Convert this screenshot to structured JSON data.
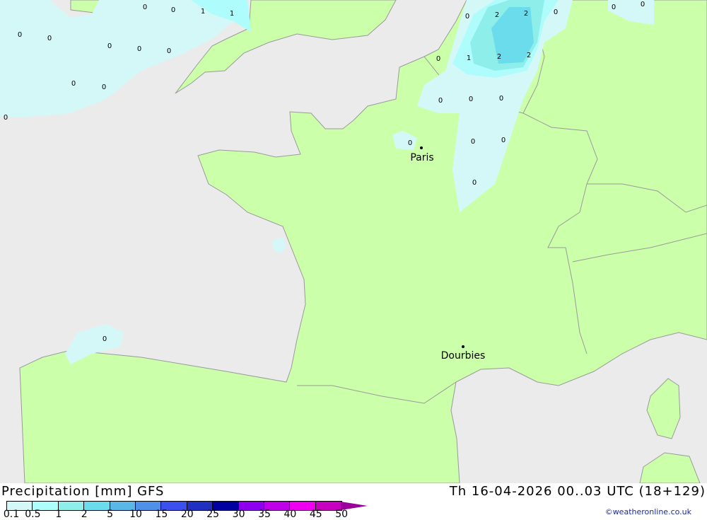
{
  "map": {
    "colors": {
      "land": "#ccffaa",
      "sea": "#ebebeb",
      "border": "#9a9a9a"
    },
    "cities": [
      {
        "name": "Paris"
      },
      {
        "name": "Dourbies"
      }
    ],
    "value_labels": [
      "0",
      "0",
      "1",
      "1",
      "0",
      "0",
      "0",
      "0",
      "0",
      "0",
      "0",
      "0",
      "0",
      "2",
      "2",
      "0",
      "0",
      "1",
      "2",
      "2",
      "0",
      "0",
      "0",
      "0",
      "0",
      "0",
      "0",
      "0",
      "0",
      "0"
    ]
  },
  "footer": {
    "title": "Precipitation [mm] GFS",
    "datetime": "Th 16-04-2026 00..03 UTC (18+129)",
    "credit": "©weatheronline.co.uk",
    "legend": [
      {
        "label": "0.1",
        "color": "#d4f8f8"
      },
      {
        "label": "0.5",
        "color": "#aefcfc"
      },
      {
        "label": "1",
        "color": "#8eeeea"
      },
      {
        "label": "2",
        "color": "#6adcec"
      },
      {
        "label": "5",
        "color": "#5ab8e8"
      },
      {
        "label": "10",
        "color": "#5090e8"
      },
      {
        "label": "15",
        "color": "#3c50f0"
      },
      {
        "label": "20",
        "color": "#2030c0"
      },
      {
        "label": "25",
        "color": "#0000a0"
      },
      {
        "label": "30",
        "color": "#9000f0"
      },
      {
        "label": "35",
        "color": "#c000e8"
      },
      {
        "label": "40",
        "color": "#f000f0"
      },
      {
        "label": "45",
        "color": "#c800c0"
      },
      {
        "label": "50",
        "color": "#9a009a"
      }
    ]
  }
}
